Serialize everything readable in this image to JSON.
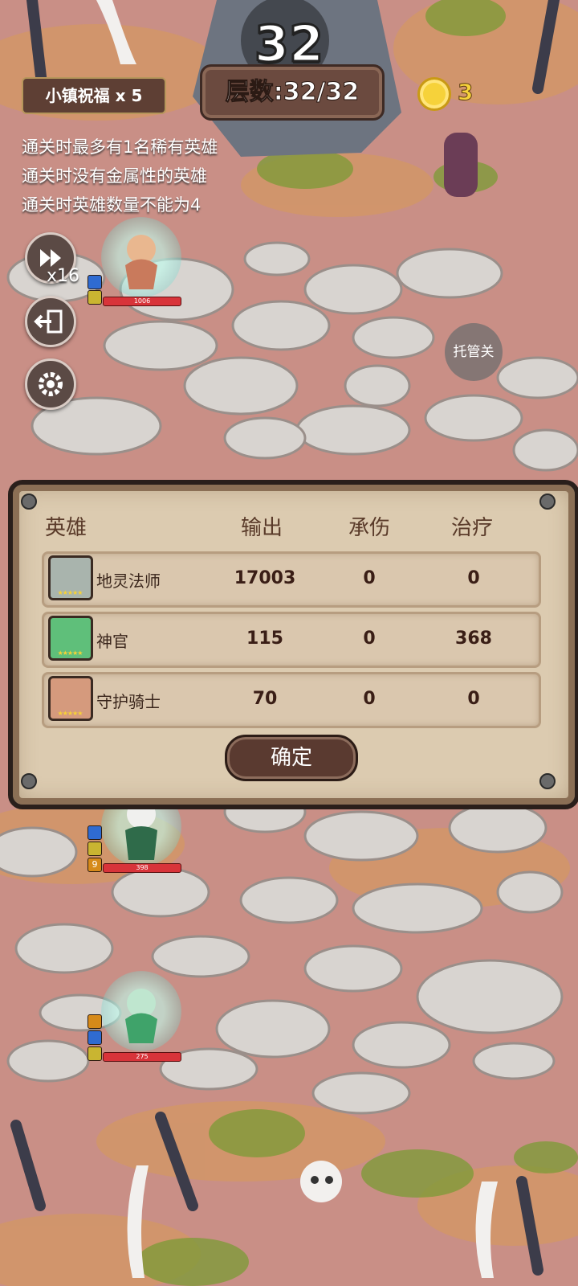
{
  "countdown": "32",
  "floor": "层数:32/32",
  "blessing": "小镇祝福 x 5",
  "coins": "3",
  "rules": [
    "通关时最多有1名稀有英雄",
    "通关时没有金属性的英雄",
    "通关时英雄数量不能为4"
  ],
  "speed": "x16",
  "auto_button": "托管关",
  "field_heroes": [
    {
      "hp": "1006"
    },
    {
      "hp": "398"
    },
    {
      "hp": "275"
    }
  ],
  "result_panel": {
    "headers": {
      "hero": "英雄",
      "output": "输出",
      "tank": "承伤",
      "heal": "治疗"
    },
    "rows": [
      {
        "name": "地灵法师",
        "output": "17003",
        "tank": "0",
        "heal": "0",
        "avatar_color": "#a9b4ad",
        "stars": "★★★★★"
      },
      {
        "name": "神官",
        "output": "115",
        "tank": "0",
        "heal": "368",
        "avatar_color": "#5fbf7a",
        "stars": "★★★★★"
      },
      {
        "name": "守护骑士",
        "output": "70",
        "tank": "0",
        "heal": "0",
        "avatar_color": "#d59a7d",
        "stars": "★★★★★"
      }
    ],
    "confirm_label": "确定"
  },
  "colors": {
    "ground": "#c98f86",
    "path": "#d8d4d0",
    "coin": "#f6d23a",
    "panel": "#dccbb0"
  }
}
